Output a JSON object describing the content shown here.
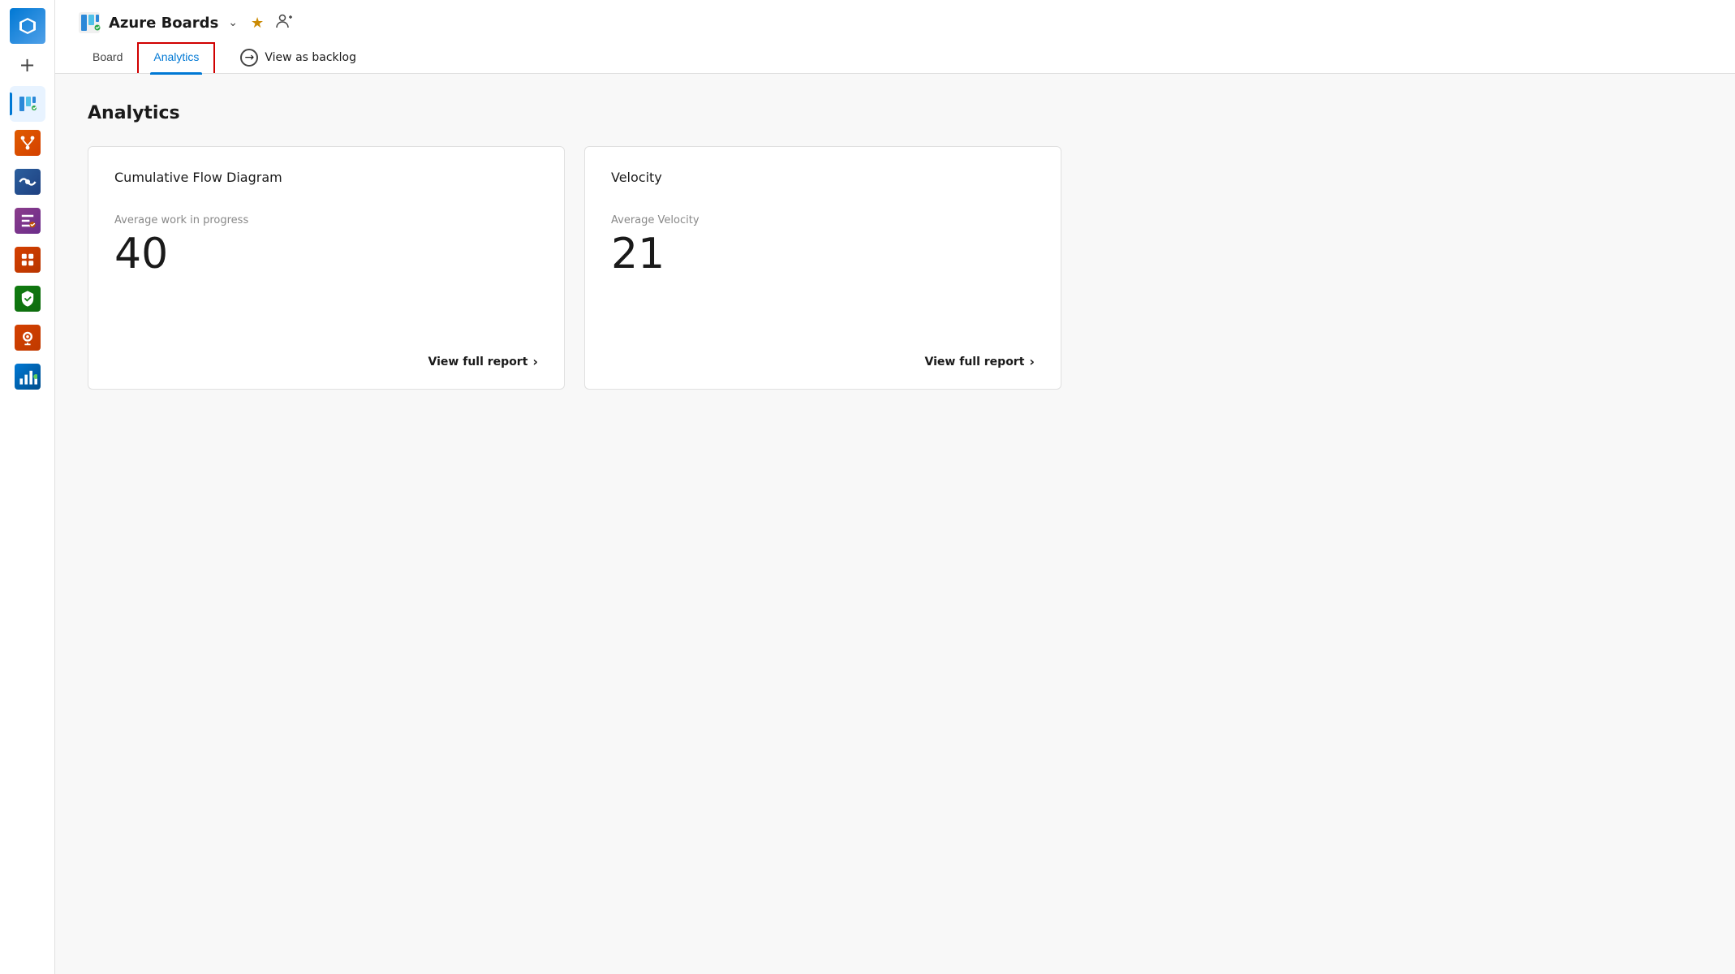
{
  "sidebar": {
    "icons": [
      {
        "name": "azure-devops-icon",
        "label": "Azure DevOps",
        "active": false
      },
      {
        "name": "add-icon",
        "label": "Add",
        "active": false
      },
      {
        "name": "boards-icon",
        "label": "Boards",
        "active": true
      },
      {
        "name": "repos-icon",
        "label": "Repos",
        "active": false
      },
      {
        "name": "pipelines-icon",
        "label": "Pipelines",
        "active": false
      },
      {
        "name": "testplans-icon",
        "label": "Test Plans",
        "active": false
      },
      {
        "name": "artifacts-icon",
        "label": "Artifacts",
        "active": false
      },
      {
        "name": "security-icon",
        "label": "Security",
        "active": false
      },
      {
        "name": "monitor-icon",
        "label": "Monitor",
        "active": false
      },
      {
        "name": "analytics-sidebar-icon",
        "label": "Analytics",
        "active": false
      }
    ]
  },
  "header": {
    "icon_label": "Azure Boards",
    "title": "Azure Boards",
    "chevron": "∨",
    "star": "★",
    "person_icon": "person-add"
  },
  "nav": {
    "tabs": [
      {
        "id": "board",
        "label": "Board",
        "active": false
      },
      {
        "id": "analytics",
        "label": "Analytics",
        "active": true
      }
    ],
    "view_as_backlog": "View as backlog"
  },
  "page": {
    "title": "Analytics",
    "cards": [
      {
        "id": "cumulative-flow",
        "title": "Cumulative Flow Diagram",
        "metric_label": "Average work in progress",
        "metric_value": "40",
        "footer_label": "View full report"
      },
      {
        "id": "velocity",
        "title": "Velocity",
        "metric_label": "Average Velocity",
        "metric_value": "21",
        "footer_label": "View full report"
      }
    ]
  }
}
